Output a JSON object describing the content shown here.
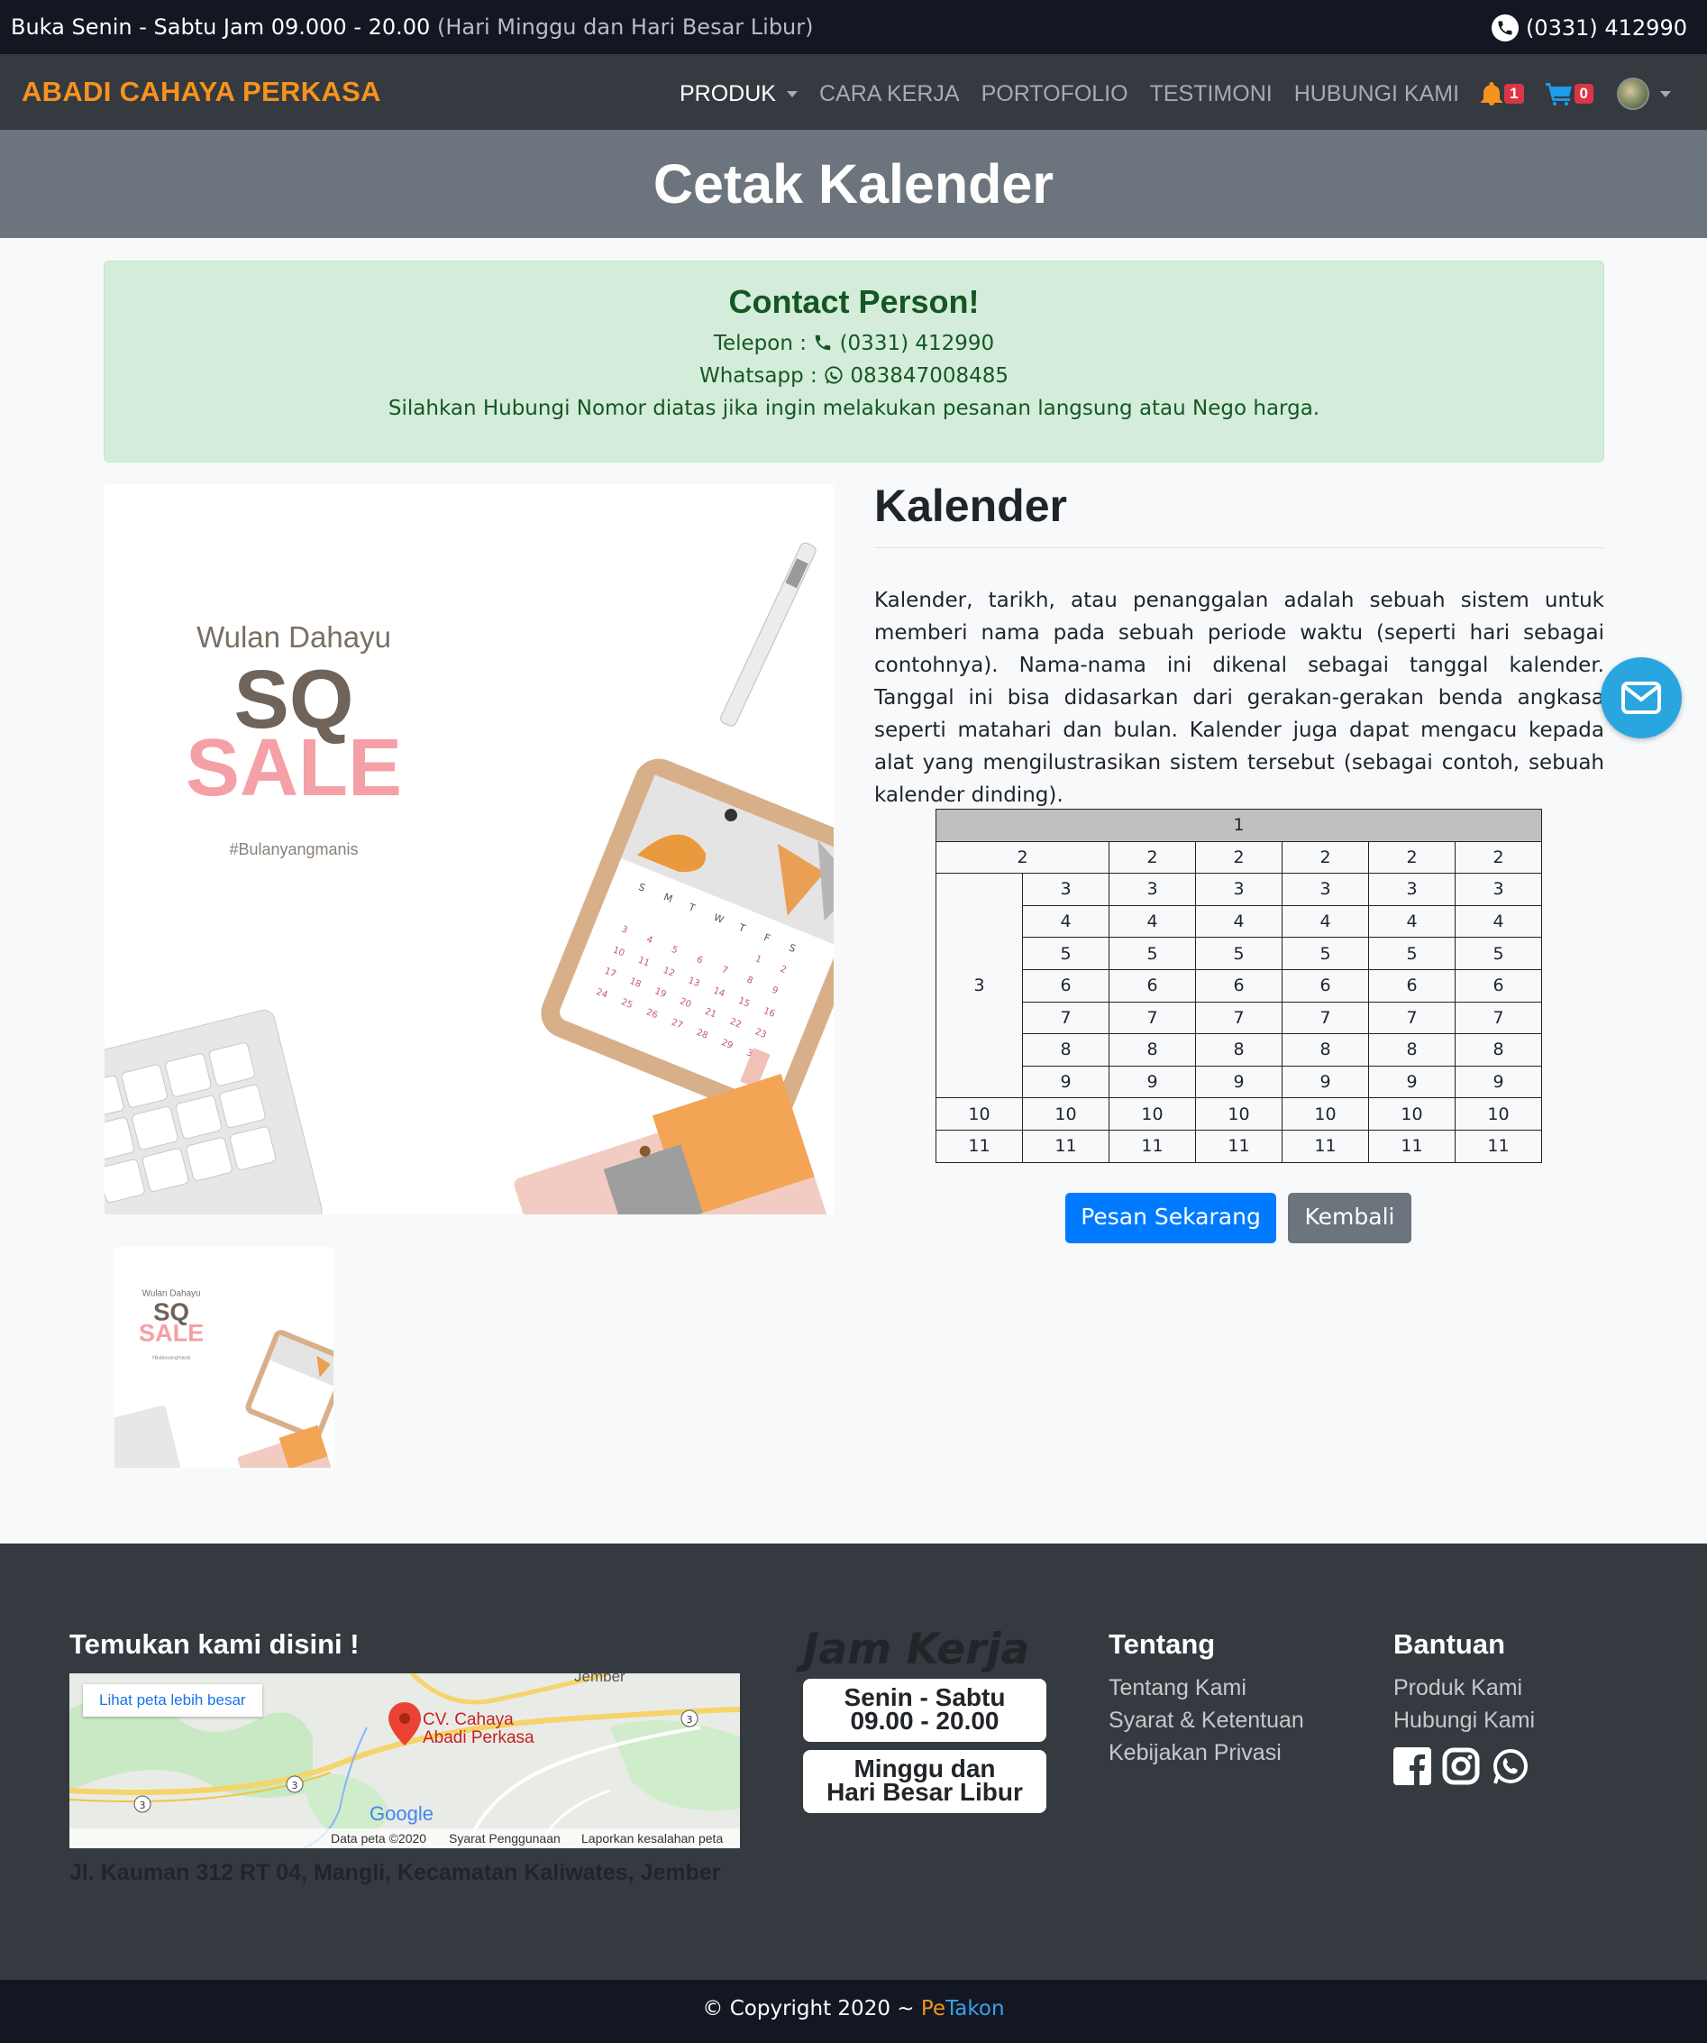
{
  "topbar": {
    "hours": "Buka Senin - Sabtu Jam 09.000 - 20.00",
    "hours_note": "(Hari Minggu dan Hari Besar Libur)",
    "phone": "(0331) 412990"
  },
  "navbar": {
    "brand": "ABADI CAHAYA PERKASA",
    "items": [
      {
        "label": "PRODUK"
      },
      {
        "label": "CARA KERJA"
      },
      {
        "label": "PORTOFOLIO"
      },
      {
        "label": "TESTIMONI"
      },
      {
        "label": "HUBUNGI KAMI"
      }
    ],
    "notif_count": "1",
    "cart_count": "0"
  },
  "page": {
    "title": "Cetak Kalender"
  },
  "contact": {
    "title": "Contact Person!",
    "telepon_label": "Telepon :",
    "telepon": "(0331) 412990",
    "whatsapp_label": "Whatsapp :",
    "whatsapp": "083847008485",
    "note": "Silahkan Hubungi Nomor diatas jika ingin melakukan pesanan langsung atau Nego harga."
  },
  "product": {
    "image_text": {
      "name": "Wulan Dahayu",
      "logo": "SQ",
      "sale": "SALE",
      "tag": "#Bulanyangmanis"
    },
    "title": "Kalender",
    "description": "Kalender, tarikh, atau penanggalan adalah sebuah sistem untuk memberi nama pada sebuah periode waktu (seperti hari sebagai contohnya). Nama-nama ini dikenal sebagai tanggal kalender. Tanggal ini bisa didasarkan dari gerakan-gerakan benda angkasa seperti matahari dan bulan. Kalender juga dapat mengacu kepada alat yang mengilustrasikan sistem tersebut (sebagai contoh, sebuah kalender dinding).",
    "table": {
      "header": "1",
      "row2": [
        "2",
        "2",
        "2",
        "2",
        "2",
        "2"
      ],
      "group_label": "3",
      "group_rows": [
        [
          "3",
          "3",
          "3",
          "3",
          "3",
          "3"
        ],
        [
          "4",
          "4",
          "4",
          "4",
          "4",
          "4"
        ],
        [
          "5",
          "5",
          "5",
          "5",
          "5",
          "5"
        ],
        [
          "6",
          "6",
          "6",
          "6",
          "6",
          "6"
        ],
        [
          "7",
          "7",
          "7",
          "7",
          "7",
          "7"
        ],
        [
          "8",
          "8",
          "8",
          "8",
          "8",
          "8"
        ],
        [
          "9",
          "9",
          "9",
          "9",
          "9",
          "9"
        ]
      ],
      "row10": [
        "10",
        "10",
        "10",
        "10",
        "10",
        "10",
        "10"
      ],
      "row11": [
        "11",
        "11",
        "11",
        "11",
        "11",
        "11",
        "11"
      ]
    },
    "order_button": "Pesan Sekarang",
    "back_button": "Kembali"
  },
  "footer": {
    "find_title": "Temukan kami disini !",
    "map": {
      "view_larger": "Lihat peta lebih besar",
      "place": "CV. Cahaya Abadi Perkasa",
      "road_label": "Jember",
      "google": "Google",
      "data": "Data peta ©2020",
      "terms": "Syarat Penggunaan",
      "report": "Laporkan kesalahan peta"
    },
    "address": "Jl. Kauman 312 RT 04, Mangli, Kecamatan Kaliwates, Jember",
    "jam_title": "Jam Kerja",
    "jam_box1_line1": "Senin - Sabtu",
    "jam_box1_line2": "09.00 - 20.00",
    "jam_box2_line1": "Minggu dan",
    "jam_box2_line2": "Hari Besar Libur",
    "tentang_title": "Tentang",
    "tentang_links": [
      "Tentang Kami",
      "Syarat & Ketentuan",
      "Kebijakan Privasi"
    ],
    "bantuan_title": "Bantuan",
    "bantuan_links": [
      "Produk Kami",
      "Hubungi Kami"
    ],
    "copyright": "© Copyright 2020 ~ ",
    "credit_pe": "Pe",
    "credit_takon": "Takon"
  }
}
